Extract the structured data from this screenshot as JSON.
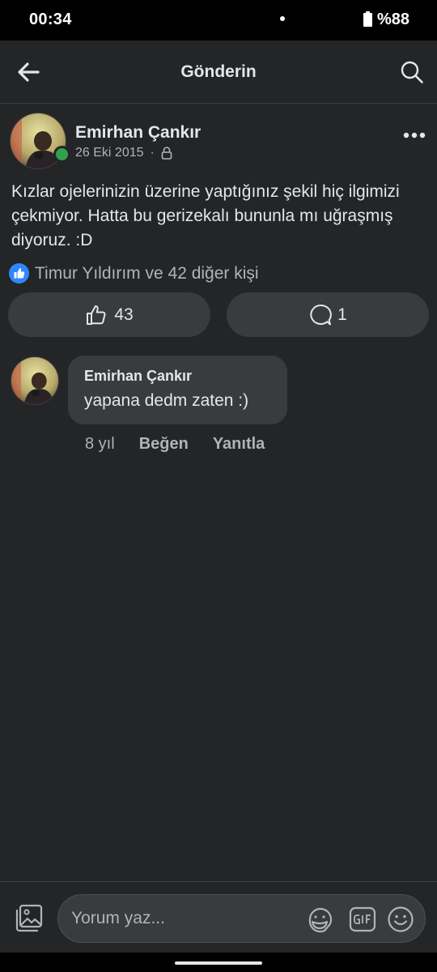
{
  "status_bar": {
    "time": "00:34",
    "battery": "%88"
  },
  "header": {
    "title": "Gönderin"
  },
  "post": {
    "author": "Emirhan Çankır",
    "date": "26 Eki 2015",
    "separator": "·",
    "text": "Kızlar ojelerinizin üzerine yaptığınız şekil hiç ilgimizi çekmiyor. Hatta bu gerizekalı bununla mı uğraşmış diyoruz. :D",
    "reactions_text": "Timur Yıldırım ve 42 diğer kişi",
    "like_count": "43",
    "comment_count": "1"
  },
  "comment": {
    "author": "Emirhan Çankır",
    "text": "yapana dedm zaten :)",
    "time": "8 yıl",
    "like_label": "Beğen",
    "reply_label": "Yanıtla"
  },
  "composer": {
    "placeholder": "Yorum yaz..."
  },
  "icons": {
    "back": "back-arrow-icon",
    "search": "search-icon",
    "more": "more-icon",
    "privacy": "lock-icon",
    "reaction": "like-reaction-icon",
    "like": "thumbs-up-icon",
    "comment": "comment-icon",
    "photo": "photo-icon",
    "sticker": "sticker-icon",
    "gif": "gif-icon",
    "emoji": "emoji-icon"
  },
  "colors": {
    "background": "#242526",
    "surface": "#3a3b3c",
    "primary_text": "#e4e6eb",
    "secondary_text": "#b0b3b8",
    "online": "#31a24c",
    "reaction_blue": "#2d88ff"
  }
}
